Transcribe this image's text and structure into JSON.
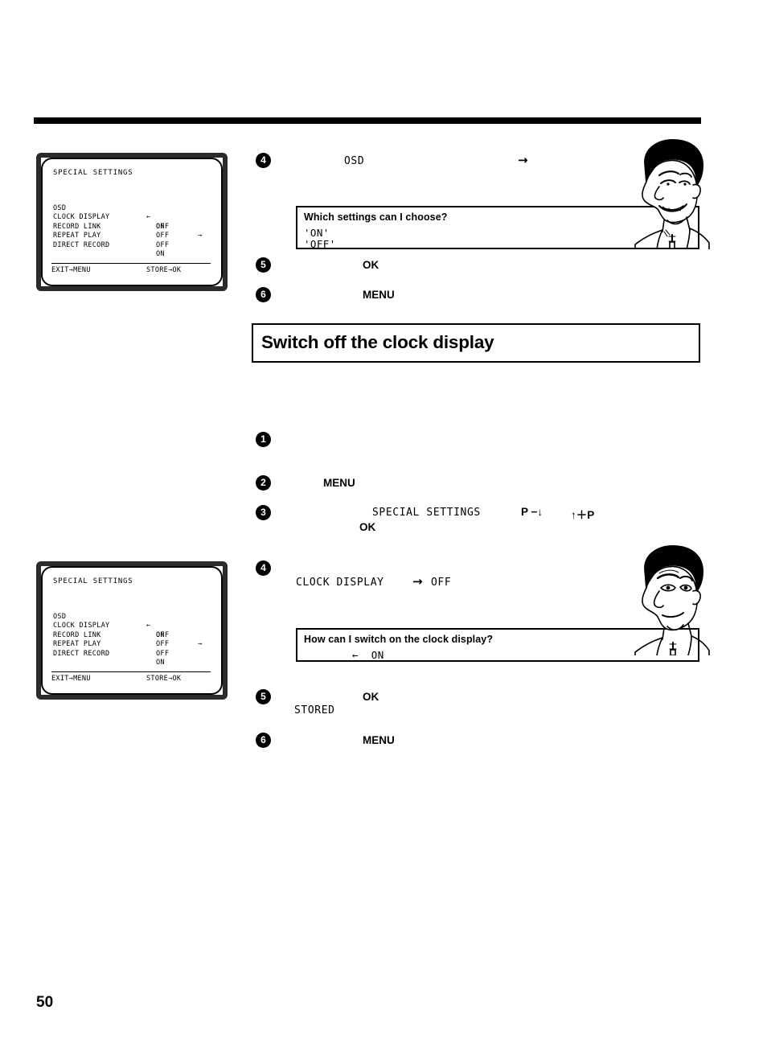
{
  "page": {
    "number": "50"
  },
  "tv_screen": {
    "title": "SPECIAL SETTINGS",
    "rows": [
      {
        "label": "OSD",
        "value": "ON",
        "arrow_left": "←",
        "arrow_right": "→"
      },
      {
        "label": "CLOCK DISPLAY",
        "value": "OFF",
        "arrow_left": "",
        "arrow_right": ""
      },
      {
        "label": "RECORD LINK",
        "value": "OFF",
        "arrow_left": "",
        "arrow_right": ""
      },
      {
        "label": "REPEAT PLAY",
        "value": "OFF",
        "arrow_left": "",
        "arrow_right": ""
      },
      {
        "label": "DIRECT RECORD",
        "value": "ON",
        "arrow_left": "",
        "arrow_right": ""
      }
    ],
    "footer_left": "EXIT→MENU",
    "footer_right": "STORE→OK"
  },
  "section_one": {
    "step4": {
      "num": "4",
      "mono_text": "OSD",
      "arrow": "→"
    },
    "tip": {
      "question": "Which settings can I choose?",
      "option1": "'ON'",
      "option2": "'OFF'"
    },
    "step5": {
      "num": "5",
      "bold_text": "OK"
    },
    "step6": {
      "num": "6",
      "bold_text": "MENU"
    }
  },
  "heading": {
    "title": "Switch off the clock display"
  },
  "section_two": {
    "step1": {
      "num": "1"
    },
    "step2": {
      "num": "2",
      "bold_text": "MENU"
    },
    "step3": {
      "num": "3",
      "mono_text": "SPECIAL SETTINGS",
      "key_down": "P −↓",
      "key_up": "↑＋P",
      "bold_text": "OK"
    },
    "step4": {
      "num": "4",
      "mono_text": "CLOCK DISPLAY",
      "arrow": "→",
      "value": "OFF"
    },
    "tip": {
      "question": "How can I switch on the clock display?",
      "answer": "←  ON"
    },
    "step5": {
      "num": "5",
      "bold_text": "OK",
      "mono_text": "STORED"
    },
    "step6": {
      "num": "6",
      "bold_text": "MENU"
    }
  }
}
